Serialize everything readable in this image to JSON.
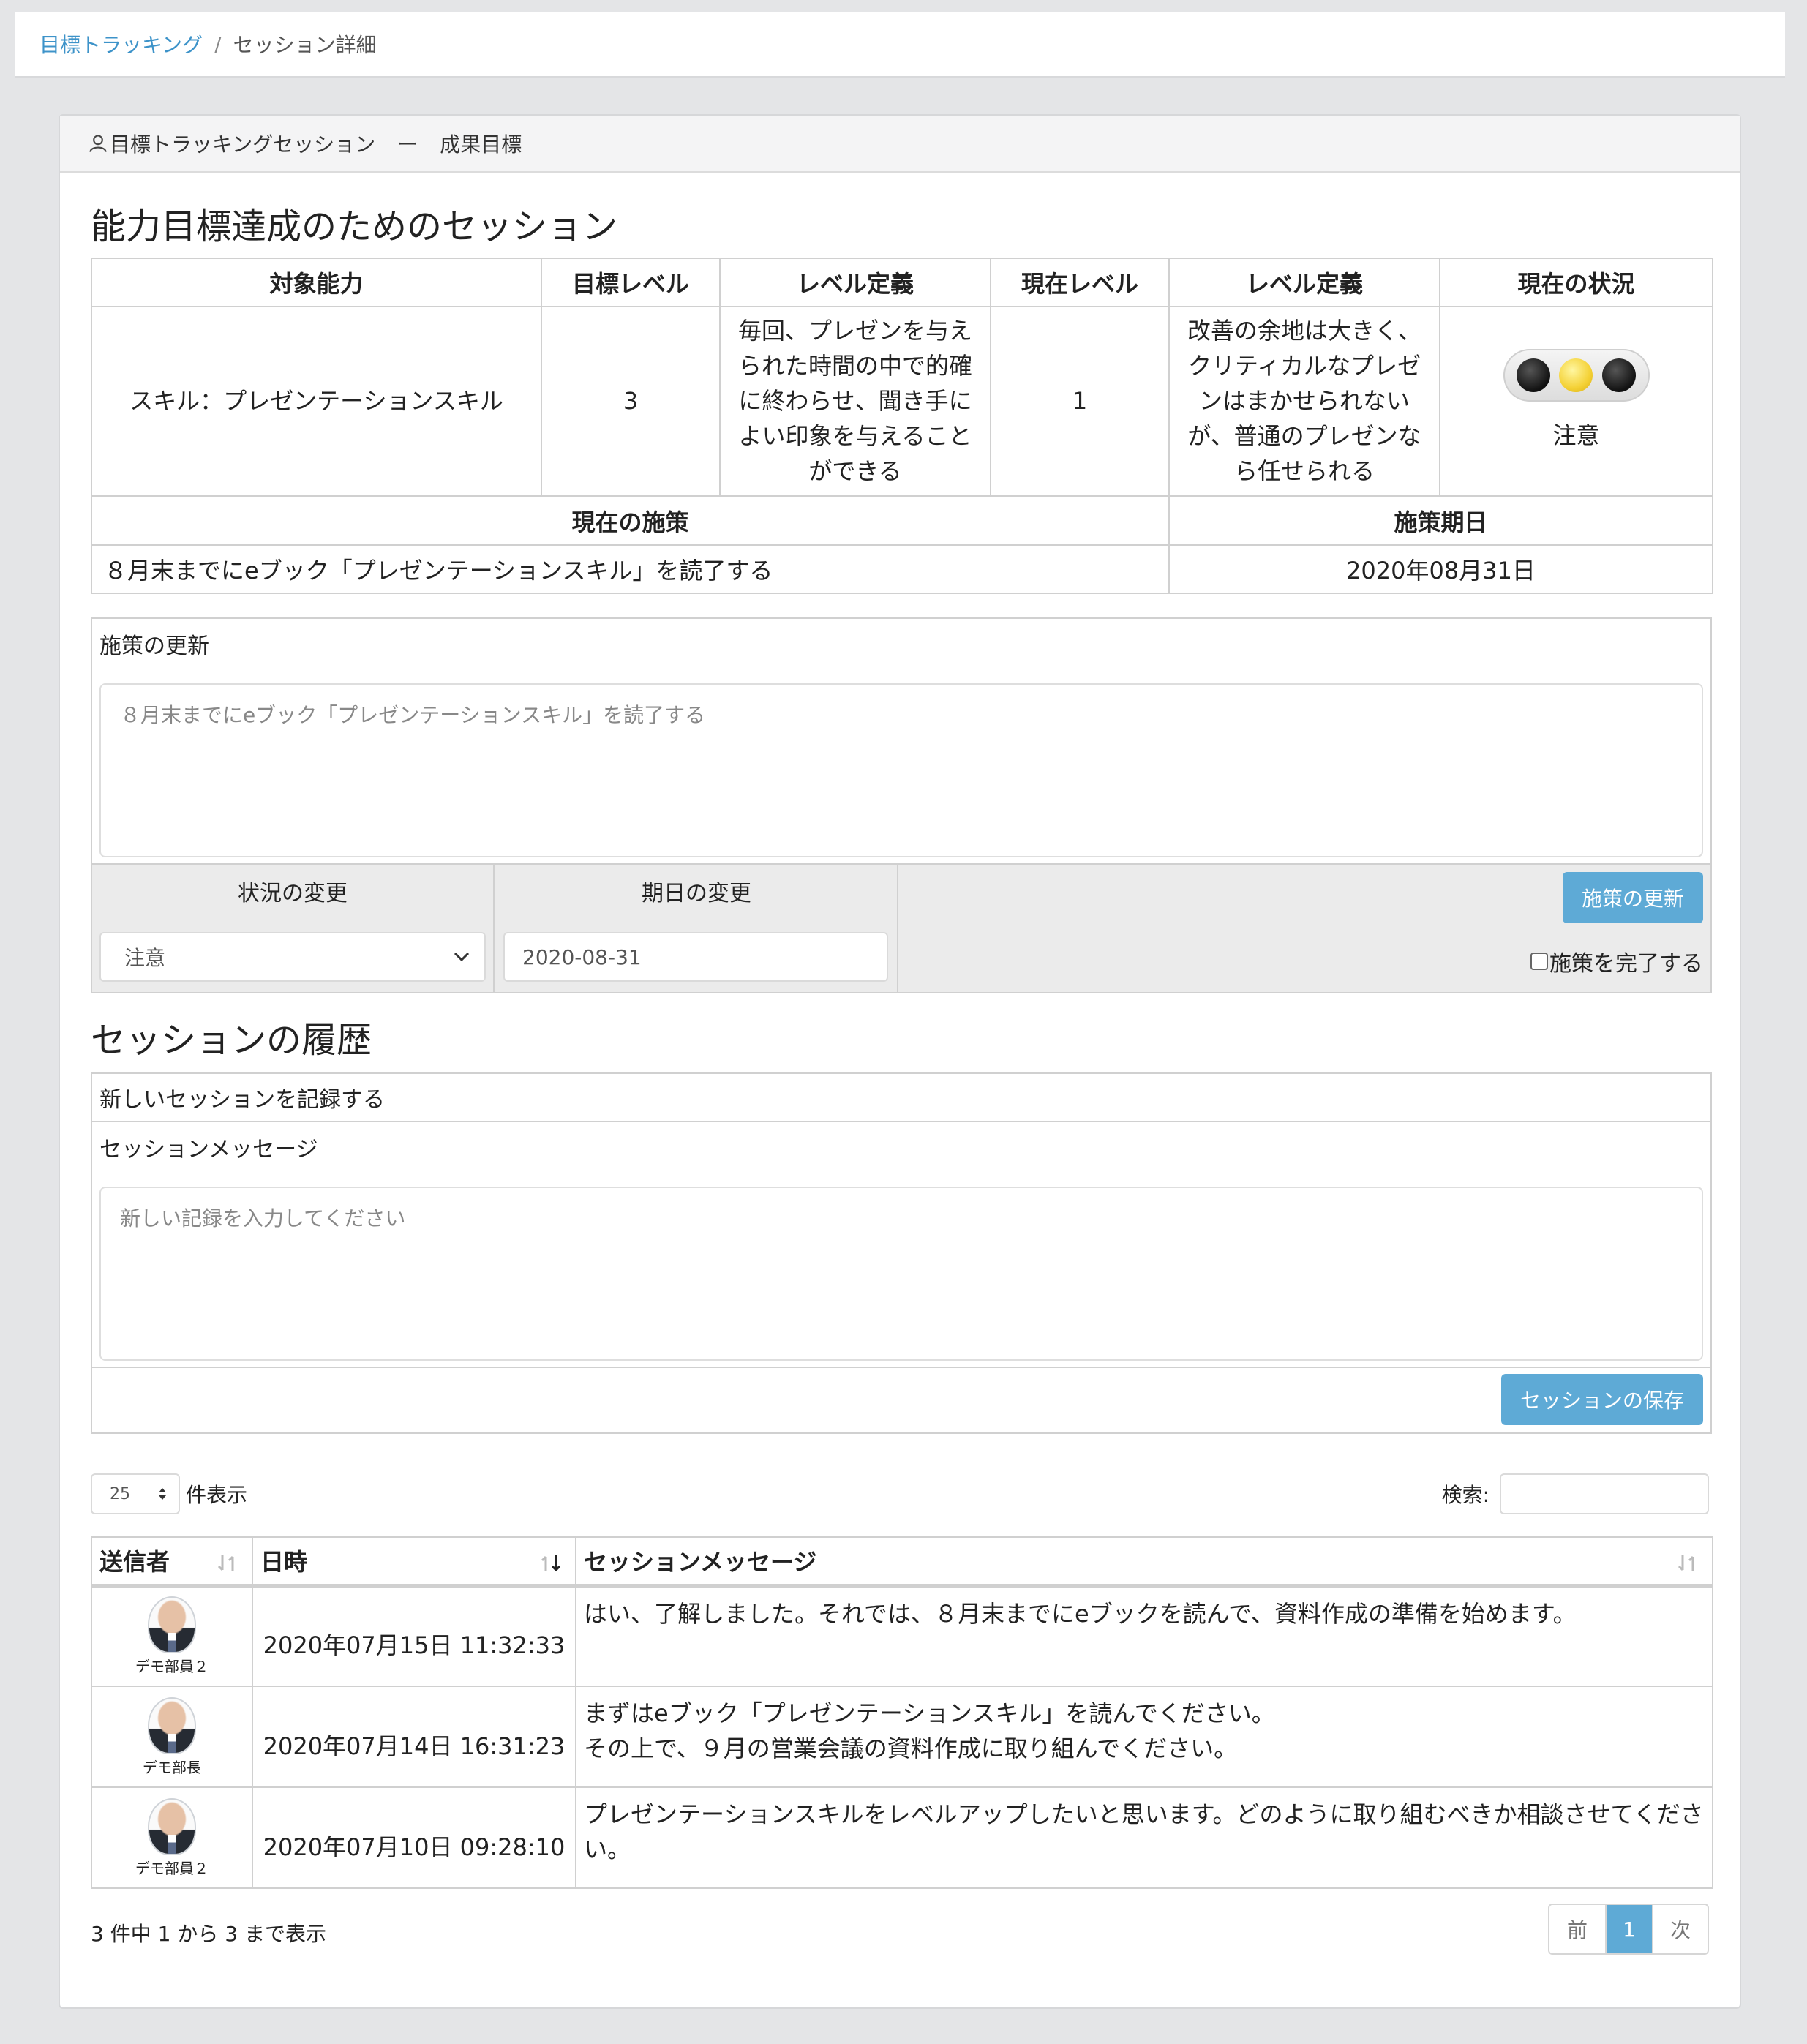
{
  "breadcrumb": {
    "parent": "目標トラッキング",
    "separator": "/",
    "current": "セッション詳細"
  },
  "header": {
    "title": "目標トラッキングセッション",
    "dash": "ー",
    "subtitle": "成果目標"
  },
  "goal_section": {
    "title": "能力目標達成のためのセッション",
    "columns": [
      "対象能力",
      "目標レベル",
      "レベル定義",
      "現在レベル",
      "レベル定義",
      "現在の状況"
    ],
    "row": {
      "ability": "スキル：プレゼンテーションスキル",
      "target_level": "3",
      "target_definition": "毎回、プレゼンを与えられた時間の中で的確に終わらせ、聞き手によい印象を与えることができる",
      "current_level": "1",
      "current_definition": "改善の余地は大きく、クリティカルなプレゼンはまかせられないが、普通のプレゼンなら任せられる",
      "status": "注意",
      "status_light": "yellow"
    },
    "measure_header": "現在の施策",
    "deadline_header": "施策期日",
    "measure": "８月末までにeブック「プレゼンテーションスキル」を読了する",
    "deadline": "2020年08月31日"
  },
  "update_panel": {
    "label": "施策の更新",
    "textarea_placeholder": "８月末までにeブック「プレゼンテーションスキル」を読了する",
    "status_label": "状況の変更",
    "status_value": "注意",
    "date_label": "期日の変更",
    "date_value": "2020-08-31",
    "update_button": "施策の更新",
    "complete_label": "施策を完了する"
  },
  "history": {
    "title": "セッションの履歴",
    "new_label": "新しいセッションを記録する",
    "message_label": "セッションメッセージ",
    "message_placeholder": "新しい記録を入力してください",
    "save_button": "セッションの保存",
    "page_size": "25",
    "page_size_suffix": "件表示",
    "search_label": "検索:",
    "columns": [
      "送信者",
      "日時",
      "セッションメッセージ"
    ],
    "rows": [
      {
        "sender": "デモ部員２",
        "datetime": "2020年07月15日 11:32:33",
        "message": "はい、了解しました。それでは、８月末までにeブックを読んで、資料作成の準備を始めます。"
      },
      {
        "sender": "デモ部長",
        "datetime": "2020年07月14日 16:31:23",
        "message": "まずはeブック「プレゼンテーションスキル」を読んでください。\nその上で、９月の営業会議の資料作成に取り組んでください。"
      },
      {
        "sender": "デモ部員２",
        "datetime": "2020年07月10日 09:28:10",
        "message": "プレゼンテーションスキルをレベルアップしたいと思います。どのように取り組むべきか相談させてください。"
      }
    ],
    "info": "3 件中 1 から 3 まで表示",
    "pagination": {
      "prev": "前",
      "current": "1",
      "next": "次"
    }
  }
}
